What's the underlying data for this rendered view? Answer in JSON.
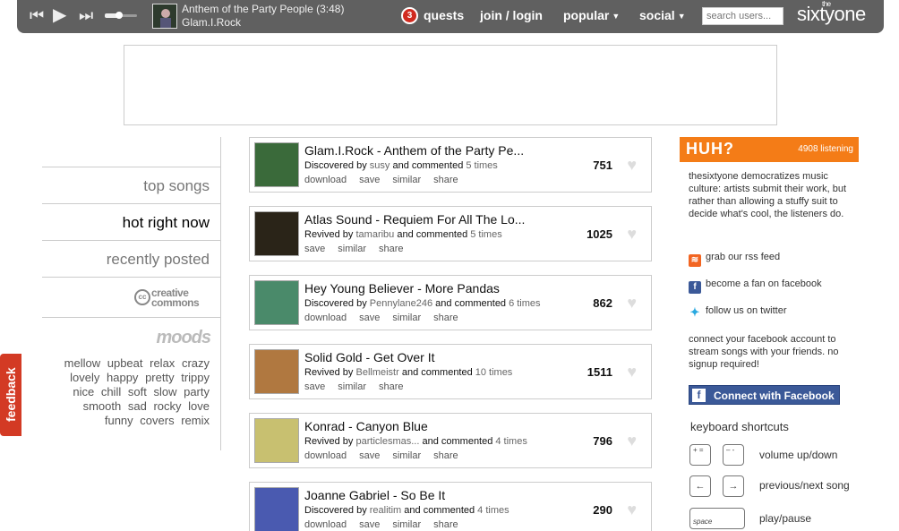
{
  "player": {
    "prev": "⏮",
    "play": "▶",
    "next": "⏭",
    "volume_level": 0.45,
    "track_title": "Anthem of the Party People (3:48)",
    "track_artist": "Glam.I.Rock"
  },
  "nav": {
    "quests_count": "3",
    "quests": "quests",
    "join": "join / login",
    "popular": "popular",
    "social": "social",
    "search_placeholder": "search users...",
    "logo": "sixtyone",
    "logo_the": "the"
  },
  "sidebar": {
    "items": [
      {
        "label": "top songs"
      },
      {
        "label": "hot right now"
      },
      {
        "label": "recently posted"
      }
    ],
    "cc_line1": "creative",
    "cc_line2": "commons",
    "cc_badge": "cc",
    "moods_title": "moods",
    "moods": [
      "mellow",
      "upbeat",
      "relax",
      "crazy",
      "lovely",
      "happy",
      "pretty",
      "trippy",
      "nice",
      "chill",
      "soft",
      "slow",
      "party",
      "smooth",
      "sad",
      "rocky",
      "love",
      "funny",
      "covers",
      "remix"
    ]
  },
  "feedback": "feedback",
  "songs": [
    {
      "title": "Glam.I.Rock - Anthem of the Party Pe...",
      "verb": "Discovered by",
      "user": "susy",
      "commented": "and commented",
      "times": "5 times",
      "actions": [
        "download",
        "save",
        "similar",
        "share"
      ],
      "count": "751",
      "thumb_color": "#3a6a3a"
    },
    {
      "title": "Atlas Sound - Requiem For All The Lo...",
      "verb": "Revived by",
      "user": "tamaribu",
      "commented": "and commented",
      "times": "5 times",
      "actions": [
        "save",
        "similar",
        "share"
      ],
      "count": "1025",
      "thumb_color": "#2a2418"
    },
    {
      "title": "Hey Young Believer - More Pandas",
      "verb": "Discovered by",
      "user": "Pennylane246",
      "commented": "and commented",
      "times": "6 times",
      "actions": [
        "download",
        "save",
        "similar",
        "share"
      ],
      "count": "862",
      "thumb_color": "#4a8a6a"
    },
    {
      "title": "Solid Gold - Get Over It",
      "verb": "Revived by",
      "user": "Bellmeistr",
      "commented": "and commented",
      "times": "10 times",
      "actions": [
        "save",
        "similar",
        "share"
      ],
      "count": "1511",
      "thumb_color": "#b07840"
    },
    {
      "title": "Konrad - Canyon Blue",
      "verb": "Revived by",
      "user": "particlesmas...",
      "commented": "and commented",
      "times": "4 times",
      "actions": [
        "download",
        "save",
        "similar",
        "share"
      ],
      "count": "796",
      "thumb_color": "#c8c070"
    },
    {
      "title": "Joanne Gabriel - So Be It",
      "verb": "Discovered by",
      "user": "realitim",
      "commented": "and commented",
      "times": "4 times",
      "actions": [
        "download",
        "save",
        "similar",
        "share"
      ],
      "count": "290",
      "thumb_color": "#4a5ab0"
    }
  ],
  "right": {
    "huh": "HUH?",
    "listening": "4908 listening",
    "desc": "thesixtyone democratizes music culture: artists submit their work, but rather than allowing a stuffy suit to decide what's cool, the listeners do.",
    "rss": "grab our rss feed",
    "fb_fan": "become a fan on facebook",
    "twitter": "follow us on twitter",
    "connect_desc": "connect your facebook account to stream songs with your friends. no signup required!",
    "connect_btn": "Connect with Facebook",
    "fb_letter": "f",
    "shortcuts_title": "keyboard shortcuts",
    "shortcuts": [
      {
        "keys": [
          "+ =",
          "– -"
        ],
        "desc": "volume up/down"
      },
      {
        "keys": [
          "←",
          "→"
        ],
        "desc": "previous/next song"
      },
      {
        "keys": [
          "space"
        ],
        "desc": "play/pause"
      }
    ]
  },
  "colors": {
    "accent": "#f47c17",
    "bar": "#606060",
    "facebook": "#3b5998",
    "feedback": "#d33a24"
  }
}
